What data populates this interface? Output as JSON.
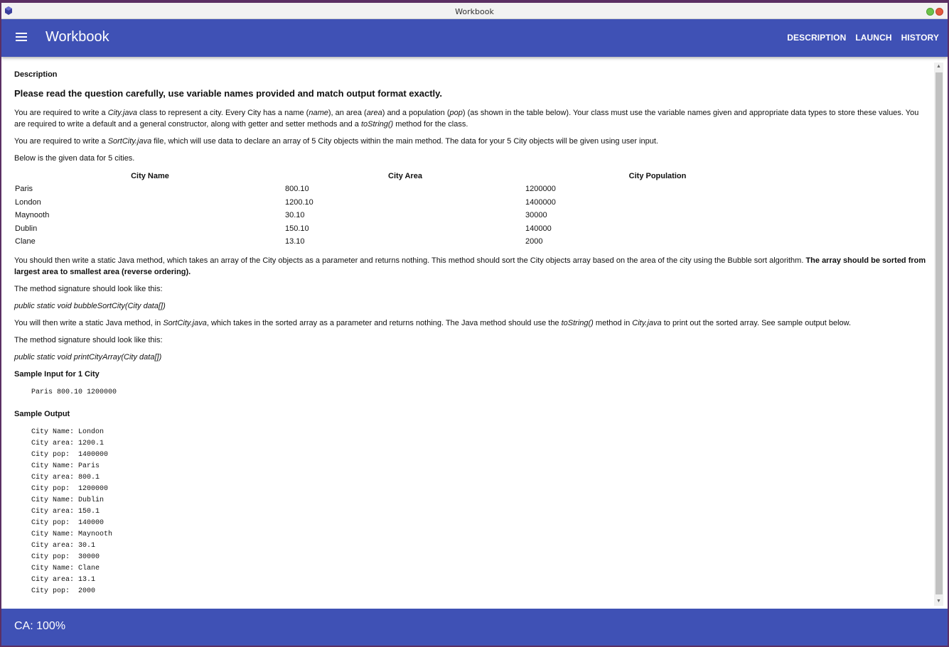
{
  "window": {
    "title": "Workbook"
  },
  "appbar": {
    "title": "Workbook",
    "nav": [
      "DESCRIPTION",
      "LAUNCH",
      "HISTORY"
    ]
  },
  "content": {
    "section_label": "Description",
    "headline": "Please read the question carefully, use variable names provided and match output format exactly.",
    "p1": {
      "a": "You are required to write a ",
      "b": "City.java",
      "c": " class to represent a city. Every City has a name (",
      "d": "name",
      "e": "), an area (",
      "f": "area",
      "g": ") and a population (",
      "h": "pop",
      "i": ") (as shown in the table below). Your class must use the variable names given and appropriate data types to store these values. You are required to write a default and a general constructor, along with getter and setter methods and a ",
      "j": "toString()",
      "k": " method for the class."
    },
    "p2": {
      "a": "You are required to write a ",
      "b": "SortCity.java",
      "c": " file, which will use data to declare an array of 5 City objects within the main method. The data for your 5 City objects will be given using user input."
    },
    "p3": "Below is the given data for 5 cities.",
    "table": {
      "headers": [
        "City Name",
        "City Area",
        "City Population"
      ],
      "rows": [
        [
          "Paris",
          "800.10",
          "1200000"
        ],
        [
          "London",
          "1200.10",
          "1400000"
        ],
        [
          "Maynooth",
          "30.10",
          "30000"
        ],
        [
          "Dublin",
          "150.10",
          "140000"
        ],
        [
          "Clane",
          "13.10",
          "2000"
        ]
      ]
    },
    "p4": {
      "a": "You should then write a static Java method, which takes an array of the City objects as a parameter and returns nothing. This method should sort the City objects array based on the area of the city using the Bubble sort algorithm. ",
      "b": "The array should be sorted from largest area to smallest area (reverse ordering)."
    },
    "p5": "The method signature should look like this:",
    "sig1": "public static void bubbleSortCity(City data[])",
    "p6": {
      "a": "You will then write a static Java method, in ",
      "b": "SortCity.java",
      "c": ", which takes in the sorted array as a parameter and returns nothing. The Java method should use the ",
      "d": "toString()",
      "e": " method in ",
      "f": "City.java",
      "g": " to print out the sorted array. See sample output below."
    },
    "p7": "The method signature should look like this:",
    "sig2": "public static void printCityArray(City data[])",
    "sample_input_label": "Sample Input for 1 City",
    "sample_input": "Paris 800.10 1200000",
    "sample_output_label": "Sample Output",
    "sample_output": "City Name: London\nCity area: 1200.1\nCity pop:  1400000\nCity Name: Paris\nCity area: 800.1\nCity pop:  1200000\nCity Name: Dublin\nCity area: 150.1\nCity pop:  140000\nCity Name: Maynooth\nCity area: 30.1\nCity pop:  30000\nCity Name: Clane\nCity area: 13.1\nCity pop:  2000"
  },
  "footer": {
    "ca": "CA: 100%"
  },
  "colors": {
    "primary": "#3f51b5",
    "desktop": "#5b2f63"
  },
  "icons": [
    "app-icon",
    "menu-icon",
    "scroll-up-icon",
    "scroll-down-icon"
  ]
}
